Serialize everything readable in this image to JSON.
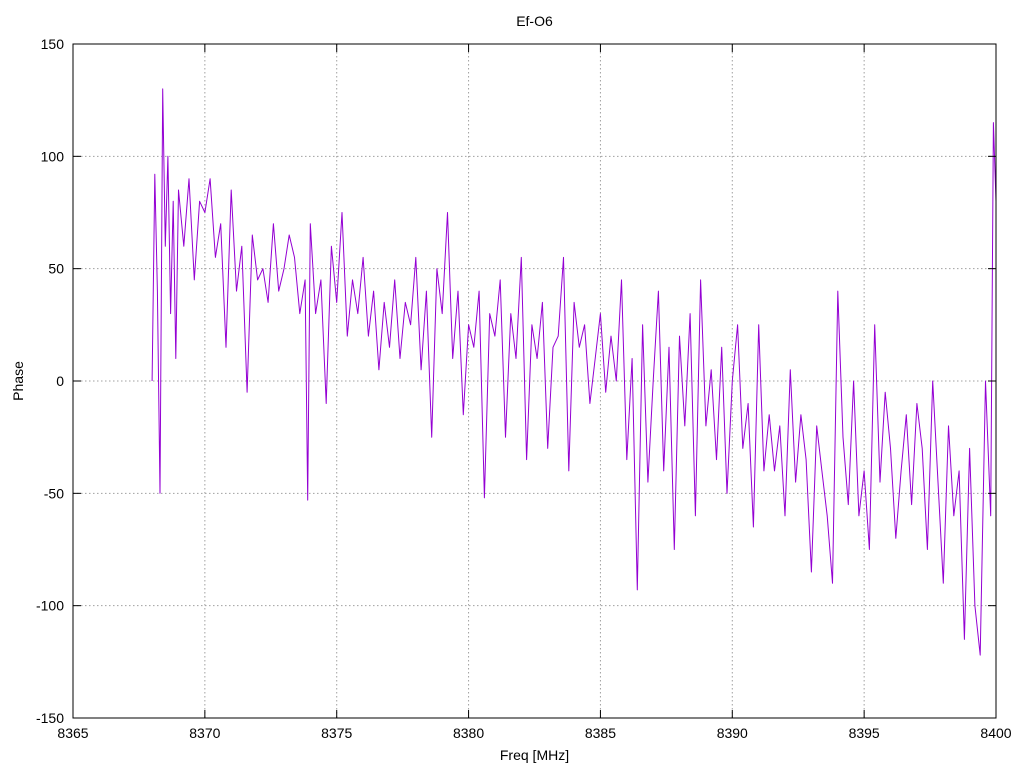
{
  "chart_data": {
    "type": "line",
    "title": "Ef-O6",
    "xlabel": "Freq [MHz]",
    "ylabel": "Phase",
    "xlim": [
      8365,
      8400
    ],
    "ylim": [
      -150,
      150
    ],
    "x_ticks": [
      8365,
      8370,
      8375,
      8380,
      8385,
      8390,
      8395,
      8400
    ],
    "y_ticks": [
      -150,
      -100,
      -50,
      0,
      50,
      100,
      150
    ],
    "grid": true,
    "legend": "none",
    "series": [
      {
        "color": "#9400d3",
        "x": [
          8368.0,
          8368.1,
          8368.2,
          8368.3,
          8368.4,
          8368.5,
          8368.6,
          8368.7,
          8368.8,
          8368.9,
          8369.0,
          8369.2,
          8369.4,
          8369.6,
          8369.8,
          8370.0,
          8370.2,
          8370.4,
          8370.6,
          8370.8,
          8371.0,
          8371.2,
          8371.4,
          8371.6,
          8371.8,
          8372.0,
          8372.2,
          8372.4,
          8372.6,
          8372.8,
          8373.0,
          8373.2,
          8373.4,
          8373.6,
          8373.8,
          8373.9,
          8374.0,
          8374.2,
          8374.4,
          8374.6,
          8374.8,
          8375.0,
          8375.2,
          8375.4,
          8375.6,
          8375.8,
          8376.0,
          8376.2,
          8376.4,
          8376.6,
          8376.8,
          8377.0,
          8377.2,
          8377.4,
          8377.6,
          8377.8,
          8378.0,
          8378.2,
          8378.4,
          8378.6,
          8378.8,
          8379.0,
          8379.2,
          8379.4,
          8379.6,
          8379.8,
          8380.0,
          8380.2,
          8380.4,
          8380.6,
          8380.8,
          8381.0,
          8381.2,
          8381.4,
          8381.6,
          8381.8,
          8382.0,
          8382.2,
          8382.4,
          8382.6,
          8382.8,
          8383.0,
          8383.2,
          8383.4,
          8383.6,
          8383.8,
          8384.0,
          8384.2,
          8384.4,
          8384.6,
          8384.8,
          8385.0,
          8385.2,
          8385.4,
          8385.6,
          8385.8,
          8386.0,
          8386.2,
          8386.4,
          8386.6,
          8386.8,
          8387.0,
          8387.2,
          8387.4,
          8387.6,
          8387.8,
          8388.0,
          8388.2,
          8388.4,
          8388.6,
          8388.8,
          8389.0,
          8389.2,
          8389.4,
          8389.6,
          8389.8,
          8390.0,
          8390.2,
          8390.4,
          8390.6,
          8390.8,
          8391.0,
          8391.2,
          8391.4,
          8391.6,
          8391.8,
          8392.0,
          8392.2,
          8392.4,
          8392.6,
          8392.8,
          8393.0,
          8393.2,
          8393.4,
          8393.6,
          8393.8,
          8394.0,
          8394.2,
          8394.4,
          8394.6,
          8394.8,
          8395.0,
          8395.2,
          8395.4,
          8395.6,
          8395.8,
          8396.0,
          8396.2,
          8396.4,
          8396.6,
          8396.8,
          8397.0,
          8397.2,
          8397.4,
          8397.6,
          8397.8,
          8398.0,
          8398.2,
          8398.4,
          8398.6,
          8398.8,
          8399.0,
          8399.2,
          8399.4,
          8399.6,
          8399.8,
          8399.9,
          8400.0
        ],
        "y": [
          0,
          92,
          40,
          -50,
          130,
          60,
          100,
          30,
          80,
          10,
          85,
          60,
          90,
          45,
          80,
          75,
          90,
          55,
          70,
          15,
          85,
          40,
          60,
          -5,
          65,
          45,
          50,
          35,
          70,
          40,
          50,
          65,
          55,
          30,
          45,
          -53,
          70,
          30,
          45,
          -10,
          60,
          35,
          75,
          20,
          45,
          30,
          55,
          20,
          40,
          5,
          35,
          15,
          45,
          10,
          35,
          25,
          55,
          5,
          40,
          -25,
          50,
          30,
          75,
          10,
          40,
          -15,
          25,
          15,
          40,
          -52,
          30,
          20,
          45,
          -25,
          30,
          10,
          55,
          -35,
          25,
          10,
          35,
          -30,
          15,
          20,
          55,
          -40,
          35,
          15,
          25,
          -10,
          10,
          30,
          -5,
          20,
          0,
          45,
          -35,
          10,
          -93,
          25,
          -45,
          0,
          40,
          -40,
          15,
          -75,
          20,
          -20,
          30,
          -60,
          45,
          -20,
          5,
          -35,
          15,
          -50,
          0,
          25,
          -30,
          -10,
          -65,
          25,
          -40,
          -15,
          -40,
          -20,
          -60,
          5,
          -45,
          -15,
          -35,
          -85,
          -20,
          -40,
          -60,
          -90,
          40,
          -25,
          -55,
          0,
          -60,
          -40,
          -75,
          25,
          -45,
          -5,
          -30,
          -70,
          -40,
          -15,
          -55,
          -10,
          -30,
          -75,
          0,
          -45,
          -90,
          -20,
          -60,
          -40,
          -115,
          -30,
          -100,
          -122,
          0,
          -60,
          115,
          80
        ]
      }
    ]
  }
}
